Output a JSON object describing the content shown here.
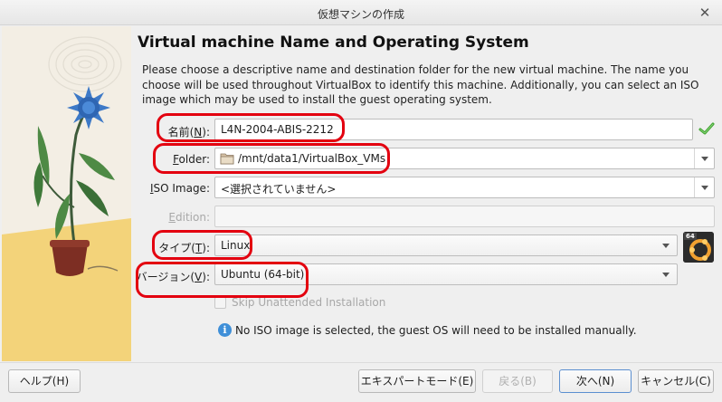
{
  "window": {
    "title": "仮想マシンの作成",
    "close_glyph": "✕"
  },
  "heading": "Virtual machine Name and Operating System",
  "description": "Please choose a descriptive name and destination folder for the new virtual machine. The name you choose will be used throughout VirtualBox to identify this machine. Additionally, you can select an ISO image which may be used to install the guest operating system.",
  "form": {
    "name": {
      "label_pre": "名前(",
      "label_key": "N",
      "label_post": "):",
      "value": "L4N-2004-ABIS-2212"
    },
    "folder": {
      "label_pre": "",
      "label_key": "F",
      "label_post": "older:",
      "value": "/mnt/data1/VirtualBox_VMs"
    },
    "iso": {
      "label_pre": "",
      "label_key": "I",
      "label_post": "SO Image:",
      "value": "<選択されていません>"
    },
    "edition": {
      "label_pre": "",
      "label_key": "E",
      "label_post": "dition:",
      "value": ""
    },
    "type": {
      "label_pre": "タイプ(",
      "label_key": "T",
      "label_post": "):",
      "value": "Linux"
    },
    "version": {
      "label_pre": "バージョン(",
      "label_key": "V",
      "label_post": "):",
      "value": "Ubuntu (64-bit)"
    },
    "skip_unattended": {
      "label": "Skip Unattended Installation",
      "checked": false,
      "enabled": false
    },
    "os_badge": "64"
  },
  "info_message": "No ISO image is selected, the guest OS will need to be installed manually.",
  "buttons": {
    "help": "ヘルプ(H)",
    "expert": "エキスパートモード(E)",
    "back": "戻る(B)",
    "next": "次へ(N)",
    "cancel": "キャンセル(C)"
  },
  "colors": {
    "highlight": "#e3000f",
    "valid_check": "#3aa12a",
    "info": "#3f8fd8"
  },
  "icons": {
    "name_status": "check-icon",
    "folder": "folder-icon",
    "info": "info-icon",
    "os": "ubuntu-os-icon"
  }
}
